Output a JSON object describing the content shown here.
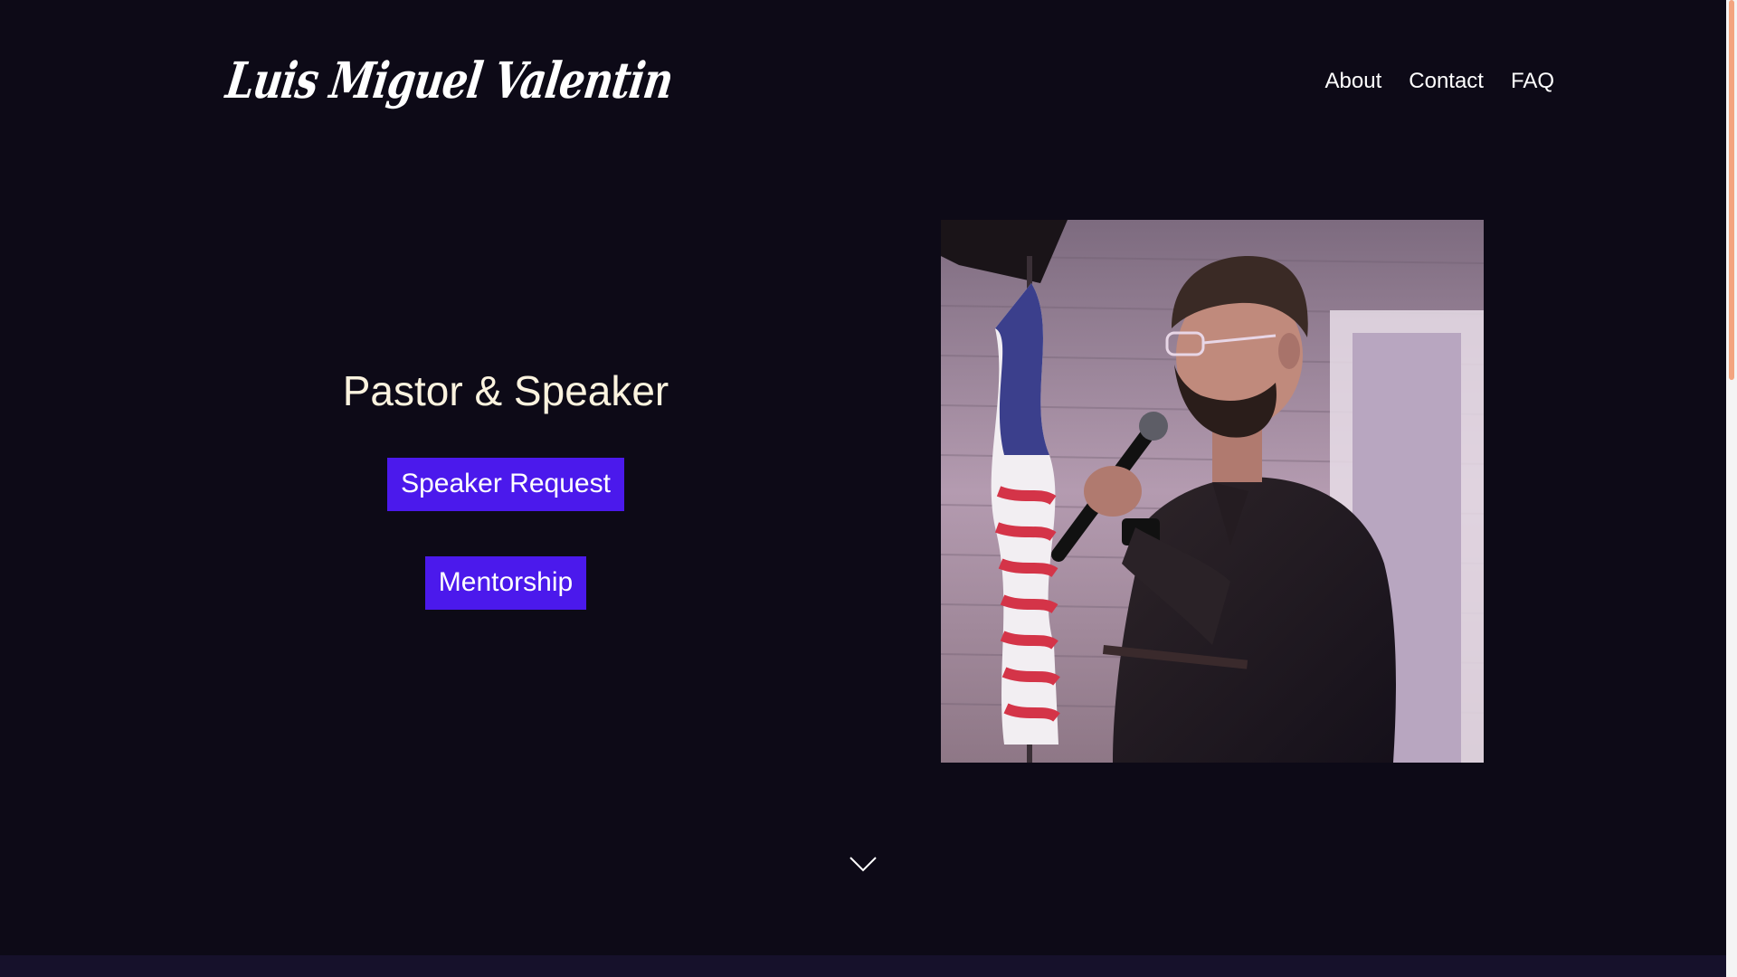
{
  "header": {
    "logo_text": "Luis Miguel Valentin",
    "nav": [
      {
        "label": "About"
      },
      {
        "label": "Contact"
      },
      {
        "label": "FAQ"
      }
    ]
  },
  "hero": {
    "title": "Pastor & Speaker",
    "buttons": {
      "speaker_request": "Speaker Request",
      "mentorship": "Mentorship"
    },
    "photo_alt": "Speaker holding a microphone next to an American flag"
  },
  "scroll": {
    "icon": "chevron-down-icon"
  },
  "colors": {
    "background": "#0d0a17",
    "accent": "#4b19ec",
    "title": "#fbf3df",
    "scrollbar_thumb": "#f3a47f"
  }
}
